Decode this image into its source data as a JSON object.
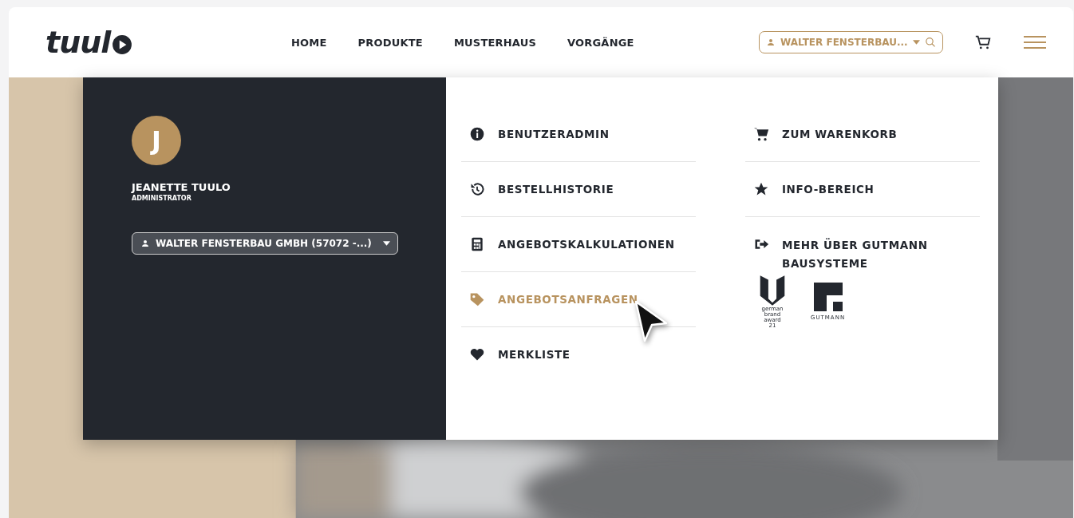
{
  "header": {
    "logo": "tuul",
    "nav": [
      {
        "label": "HOME"
      },
      {
        "label": "PRODUKTE"
      },
      {
        "label": "MUSTERHAUS"
      },
      {
        "label": "VORGÄNGE"
      }
    ],
    "account_select": {
      "value": "WALTER FENSTERBAU..."
    }
  },
  "profile": {
    "initial": "J",
    "name": "JEANETTE TUULO",
    "role": "ADMINISTRATOR",
    "account_select": {
      "value": "WALTER FENSTERBAU GMBH (57072 -...)"
    }
  },
  "menu_left": [
    {
      "label": "BENUTZERADMIN",
      "selected": false
    },
    {
      "label": "BESTELLHISTORIE",
      "selected": false
    },
    {
      "label": "ANGEBOTSKALKULATIONEN",
      "selected": false
    },
    {
      "label": "ANGEBOTSANFRAGEN",
      "selected": true
    },
    {
      "label": "MERKLISTE",
      "selected": false
    }
  ],
  "menu_right": [
    {
      "label": "ZUM WARENKORB",
      "selected": false
    },
    {
      "label": "INFO-BEREICH",
      "selected": false
    },
    {
      "label": "MEHR ÜBER GUTMANN BAUSYSTEME",
      "selected": false
    }
  ],
  "logos": {
    "award": [
      "german",
      "brand",
      "award",
      "21"
    ],
    "brand": "GUTMANN"
  }
}
